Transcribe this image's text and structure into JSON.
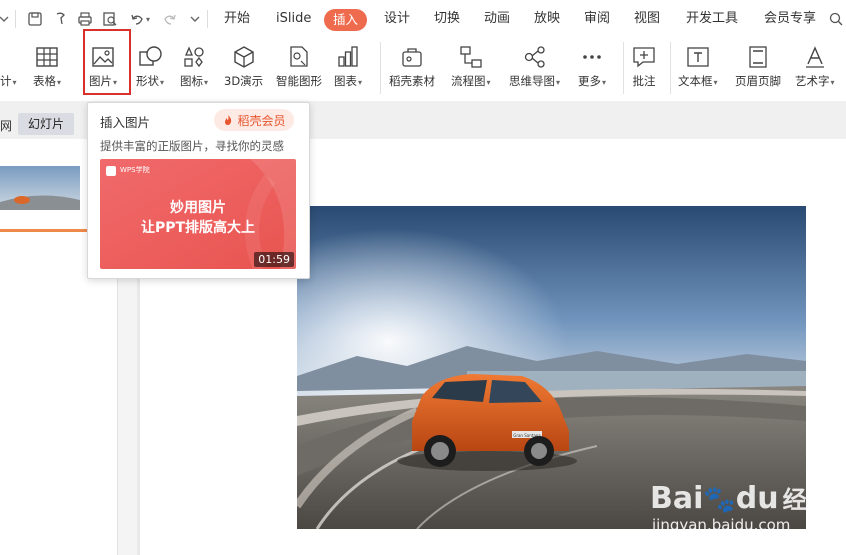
{
  "menu": {
    "tabs": [
      "开始",
      "iSlide",
      "插入",
      "设计",
      "切换",
      "动画",
      "放映",
      "审阅",
      "视图",
      "开发工具",
      "会员专享"
    ],
    "active": "插入"
  },
  "ribbon": {
    "table": "表格",
    "picture": "图片",
    "shape": "形状",
    "icon": "图标",
    "model3d": "3D演示",
    "smartart": "智能图形",
    "chart": "图表",
    "material": "稻壳素材",
    "flowchart": "流程图",
    "mindmap": "思维导图",
    "more": "更多",
    "comment": "批注",
    "textbox": "文本框",
    "headerfooter": "页眉页脚",
    "wordart": "艺术字"
  },
  "panel": {
    "tab_partial": "网",
    "tab_slides": "幻灯片",
    "cut_partial": "计"
  },
  "popover": {
    "title": "插入图片",
    "badge": "稻壳会员",
    "desc": "提供丰富的正版图片，寻找你的灵感",
    "thumb_brand": "WPS学院",
    "thumb_line1": "妙用图片",
    "thumb_line2": "让PPT排版高大上",
    "duration": "01:59"
  },
  "photo": {
    "plate": "Gran Santana"
  },
  "watermark": {
    "brand_a": "Bai",
    "brand_b": "du",
    "brand_c": "经验",
    "url": "jingyan.baidu.com"
  },
  "colors": {
    "accent": "#ef6b4e",
    "highlight": "#d9302c"
  }
}
